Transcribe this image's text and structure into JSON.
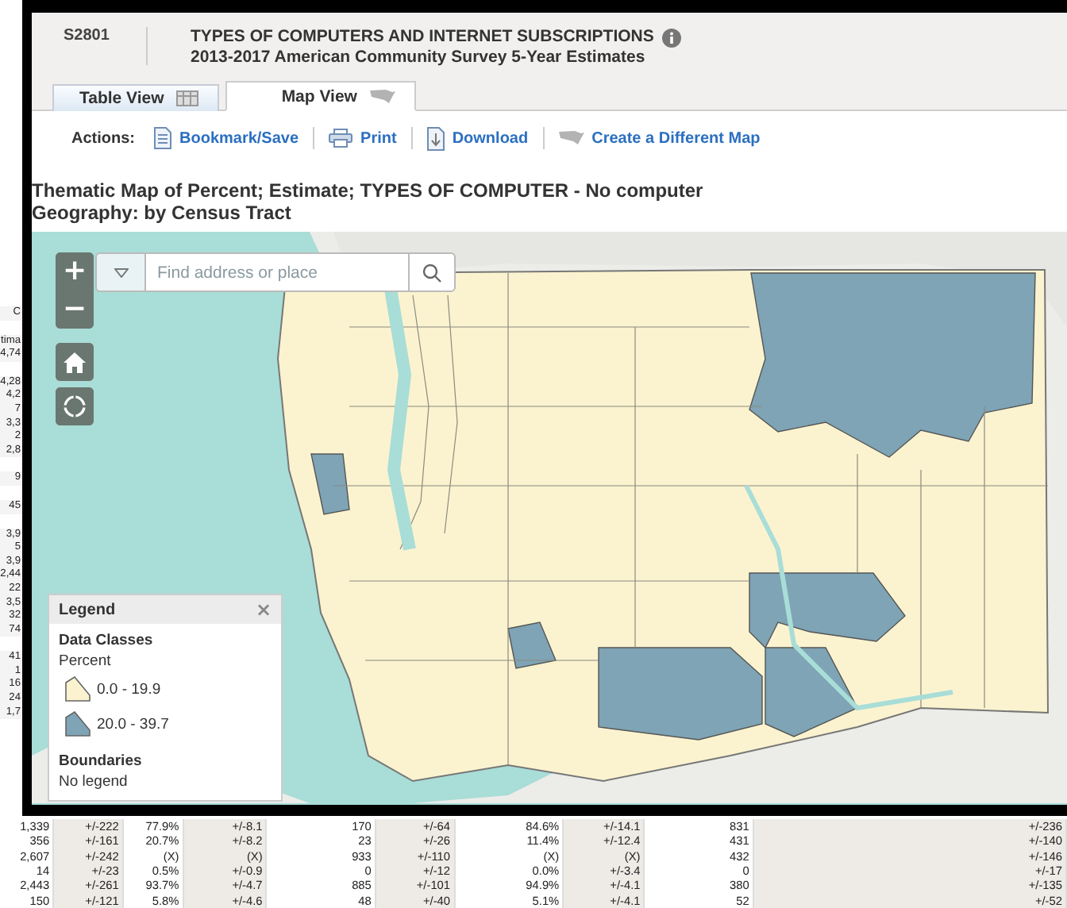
{
  "background_table": {
    "left_column_groups": [
      [
        "C"
      ],
      [
        "tima",
        "4,74"
      ],
      [
        "4,28",
        "4,2",
        "7",
        "3,3",
        "2",
        "2,8"
      ],
      [
        "9"
      ],
      [
        "45"
      ],
      [
        "3,9",
        "5",
        "3,9",
        "2,44",
        "22",
        "3,5",
        "32",
        "74"
      ],
      [
        "41",
        "1",
        "16",
        "24",
        "1,7"
      ]
    ],
    "rows": [
      [
        "1,339",
        "+/-222",
        "77.9%",
        "+/-8.1",
        "170",
        "+/-64",
        "84.6%",
        "+/-14.1",
        "831",
        "+/-236"
      ],
      [
        "356",
        "+/-161",
        "20.7%",
        "+/-8.2",
        "23",
        "+/-26",
        "11.4%",
        "+/-12.4",
        "431",
        "+/-140"
      ],
      [
        "2,607",
        "+/-242",
        "(X)",
        "(X)",
        "933",
        "+/-110",
        "(X)",
        "(X)",
        "432",
        "+/-146"
      ],
      [
        "14",
        "+/-23",
        "0.5%",
        "+/-0.9",
        "0",
        "+/-12",
        "0.0%",
        "+/-3.4",
        "0",
        "+/-17"
      ],
      [
        "2,443",
        "+/-261",
        "93.7%",
        "+/-4.7",
        "885",
        "+/-101",
        "94.9%",
        "+/-4.1",
        "380",
        "+/-135"
      ],
      [
        "150",
        "+/-121",
        "5.8%",
        "+/-4.6",
        "48",
        "+/-40",
        "5.1%",
        "+/-4.1",
        "52",
        "+/-52"
      ]
    ]
  },
  "header": {
    "id": "S2801",
    "title": "TYPES OF COMPUTERS AND INTERNET SUBSCRIPTIONS",
    "subtitle": "2013-2017 American Community Survey 5-Year Estimates"
  },
  "tabs": [
    {
      "label": "Table View",
      "kind": "table",
      "selected": false
    },
    {
      "label": "Map View",
      "kind": "map",
      "selected": true
    }
  ],
  "actions": {
    "label": "Actions:",
    "items": [
      {
        "label": "Bookmark/Save",
        "kind": "bookmark"
      },
      {
        "label": "Print",
        "kind": "print"
      },
      {
        "label": "Download",
        "kind": "download"
      },
      {
        "label": "Create a Different Map",
        "kind": "map"
      }
    ]
  },
  "map_title": [
    "Thematic Map of Percent; Estimate; TYPES OF COMPUTER - No computer",
    "Geography: by Census Tract"
  ],
  "map": {
    "zoom_in": "+",
    "zoom_out": "−",
    "search": {
      "placeholder": "Find address or place"
    }
  },
  "legend": {
    "title": "Legend",
    "close": "×",
    "section": "Data Classes",
    "unit": "Percent",
    "classes": [
      {
        "label": "0.0 - 19.9",
        "color": "#fbf3cf"
      },
      {
        "label": "20.0 - 39.7",
        "color": "#7ea4b5"
      }
    ],
    "boundaries_title": "Boundaries",
    "boundaries_text": "No legend"
  }
}
